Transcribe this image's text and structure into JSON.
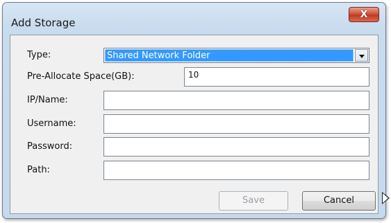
{
  "window": {
    "title": "Add Storage",
    "close_glyph": "X"
  },
  "form": {
    "type": {
      "label": "Type:",
      "value": "Shared Network Folder"
    },
    "preallocate": {
      "label": "Pre-Allocate Space(GB):",
      "value": "10"
    },
    "ip_name": {
      "label": "IP/Name:",
      "value": ""
    },
    "username": {
      "label": "Username:",
      "value": ""
    },
    "password": {
      "label": "Password:",
      "value": ""
    },
    "path": {
      "label": "Path:",
      "value": ""
    }
  },
  "buttons": {
    "save": "Save",
    "cancel": "Cancel"
  },
  "icons": {
    "close": "close-icon",
    "dropdown": "chevron-down-icon",
    "cursor": "mouse-cursor-icon"
  },
  "colors": {
    "selection": "#3399ff",
    "close_button": "#c13a25",
    "window_frame": "#c9dbee"
  }
}
